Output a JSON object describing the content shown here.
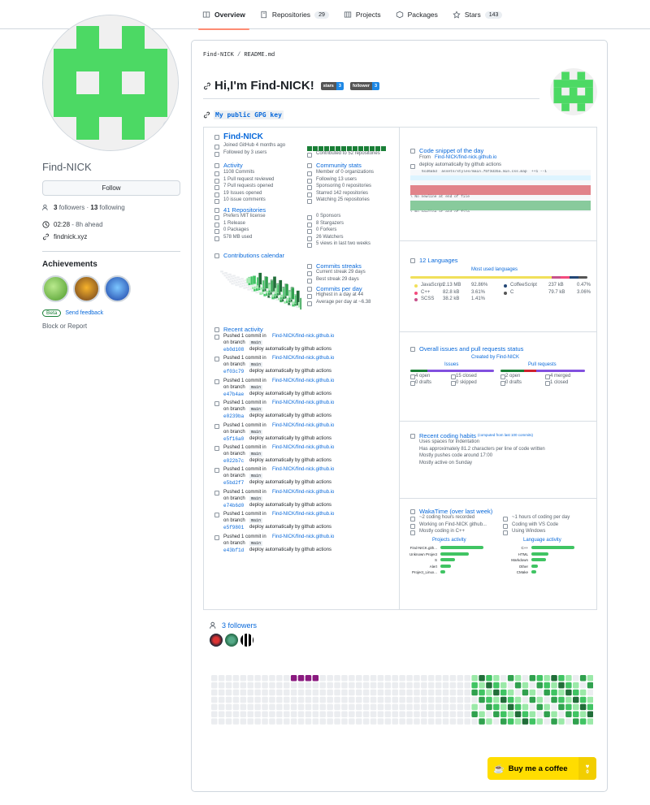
{
  "nav": {
    "tabs": [
      {
        "label": "Overview",
        "count": ""
      },
      {
        "label": "Repositories",
        "count": "29"
      },
      {
        "label": "Projects",
        "count": ""
      },
      {
        "label": "Packages",
        "count": ""
      },
      {
        "label": "Stars",
        "count": "143"
      }
    ]
  },
  "profile": {
    "username": "Find-NICK",
    "follow_label": "Follow",
    "followers_count": "3",
    "followers_word": "followers",
    "following_count": "13",
    "following_word": "following",
    "time": "02:28",
    "time_note": "- 8h ahead",
    "website": "findnick.xyz",
    "achievements_title": "Achievements",
    "beta_label": "Beta",
    "feedback_label": "Send feedback",
    "block_label": "Block or Report"
  },
  "readme": {
    "crumb_user": "Find-NICK",
    "crumb_file": "README.md",
    "heading": "Hi,I'm Find-NICK!",
    "shield_stars_label": "stars",
    "shield_stars_value": "3",
    "shield_follower_label": "follower",
    "shield_follower_value": "3",
    "gpg_link": "My public GPG key"
  },
  "metrics": {
    "name": "Find-NICK",
    "joined": "Joined GitHub 4 months ago",
    "followed_by": "Followed by 3 users",
    "contributed": "Contributed to 52 repositories",
    "activity_title": "Activity",
    "activity": [
      "1108 Commits",
      "1 Pull request reviewed",
      "7 Pull requests opened",
      "19 Issues opened",
      "10 issue comments"
    ],
    "community_title": "Community stats",
    "community": [
      "Member of 0 organizations",
      "Following 13 users",
      "Sponsoring 0 repositories",
      "Starred 142 repositories",
      "Watching 25 repositories"
    ],
    "repos_title": "41 Repositories",
    "repos": [
      "Prefers MIT license",
      "1 Release",
      "0 Packages",
      "578 MB used"
    ],
    "repos_right": [
      "0 Sponsors",
      "8 Stargazers",
      "0 Forkers",
      "26 Watchers",
      "5 views in last two weeks"
    ],
    "calendar_title": "Contributions calendar",
    "streak_title": "Commits streaks",
    "streak": [
      "Current streak 29 days",
      "Best streak 29 days"
    ],
    "perday_title": "Commits per day",
    "perday": [
      "Highest in a day at 44",
      "Average per day at ~6.38"
    ],
    "recent_title": "Recent activity",
    "recent": [
      {
        "hash": "eb0d108",
        "repo": "Find-NICK/find-nick.github.io"
      },
      {
        "hash": "ef03c79",
        "repo": "Find-NICK/find-nick.github.io"
      },
      {
        "hash": "e47b4ae",
        "repo": "Find-NICK/find-nick.github.io"
      },
      {
        "hash": "e0239ba",
        "repo": "Find-NICK/find-nick.github.io"
      },
      {
        "hash": "e5f16a0",
        "repo": "Find-NICK/find-nick.github.io"
      },
      {
        "hash": "e022b7c",
        "repo": "Find-NICK/find-nick.github.io"
      },
      {
        "hash": "e5bd2f7",
        "repo": "Find-NICK/find-nick.github.io"
      },
      {
        "hash": "e74b6d0",
        "repo": "Find-NICK/find-nick.github.io"
      },
      {
        "hash": "e5f9801",
        "repo": "Find-NICK/find-nick.github.io"
      },
      {
        "hash": "e43bf1d",
        "repo": "Find-NICK/find-nick.github.io"
      }
    ],
    "recent_pushed": "Pushed 1 commit in",
    "recent_branch": "on branch",
    "recent_branch_name": "main",
    "recent_msg": "deploy automatically by github actions",
    "snippet_title": "Code snippet of the day",
    "snippet_from": "From",
    "snippet_repo": "Find-NICK/find-nick.github.io",
    "snippet_msg": "deploy automatically by github actions",
    "snippet_hash": "5cd6abd",
    "snippet_path": "assets/styles/main.7bf3d2ba.min.css.map",
    "snippet_stat": "++1 --1",
    "snippet_eof1": "\\ No newline at end of file",
    "snippet_eof2": "\\ No newline at end of file",
    "languages_title": "12 Languages",
    "languages_sub": "Most used languages",
    "languages": [
      {
        "name": "JavaScript",
        "size": "2.13 MB",
        "pct": "92.86%",
        "color": "#f1e05a"
      },
      {
        "name": "C++",
        "size": "82.8 kB",
        "pct": "3.61%",
        "color": "#f34b7d"
      },
      {
        "name": "SCSS",
        "size": "38.2 kB",
        "pct": "1.41%",
        "color": "#c6538c"
      },
      {
        "name": "CoffeeScript",
        "size": "237 kB",
        "pct": "0.47%",
        "color": "#244776"
      },
      {
        "name": "C",
        "size": "79.7 kB",
        "pct": "3.06%",
        "color": "#555555"
      }
    ],
    "issues_title": "Overall issues and pull requests status",
    "created_by": "Created by Find-NICK",
    "issues_label": "Issues",
    "prs_label": "Pull requests",
    "issues_stats": [
      "4 open",
      "15 closed",
      "0 drafts",
      "0 skipped"
    ],
    "prs_stats": [
      "2 open",
      "4 merged",
      "0 drafts",
      "1 closed"
    ],
    "habits_title": "Recent coding habits",
    "habits_note": "(computed from last 100 commits)",
    "habits": [
      "Uses spaces for indentation",
      "Has approximately 81.2 characters per line of code written",
      "Mostly pushes code around 17:00",
      "Mostly active on Sunday"
    ],
    "waka_title": "WakaTime (over last week)",
    "waka_left": [
      "~2 coding hours recorded",
      "Working on Find-NICK github...",
      "Mostly coding in C++"
    ],
    "waka_right": [
      "~1 hours of coding per day",
      "Coding with VS Code",
      "Using Windows"
    ],
    "projects_title": "Projects activity",
    "projects": [
      {
        "name": "Find-NICK.gith...",
        "v": 0.75
      },
      {
        "name": "Unknown Project",
        "v": 0.5
      },
      {
        "name": "S",
        "v": 0.25
      },
      {
        "name": "Alert",
        "v": 0.18
      },
      {
        "name": "Project_Linux...",
        "v": 0.08
      }
    ],
    "lang_activity_title": "Language activity",
    "lang_activity": [
      {
        "name": "C++",
        "v": 0.75
      },
      {
        "name": "HTML",
        "v": 0.3
      },
      {
        "name": "Markdown",
        "v": 0.25
      },
      {
        "name": "Other",
        "v": 0.12
      },
      {
        "name": "CMake",
        "v": 0.08
      }
    ]
  },
  "followers": {
    "title": "3 followers"
  },
  "bmac": {
    "label": "Buy me a coffee",
    "count": "0"
  }
}
